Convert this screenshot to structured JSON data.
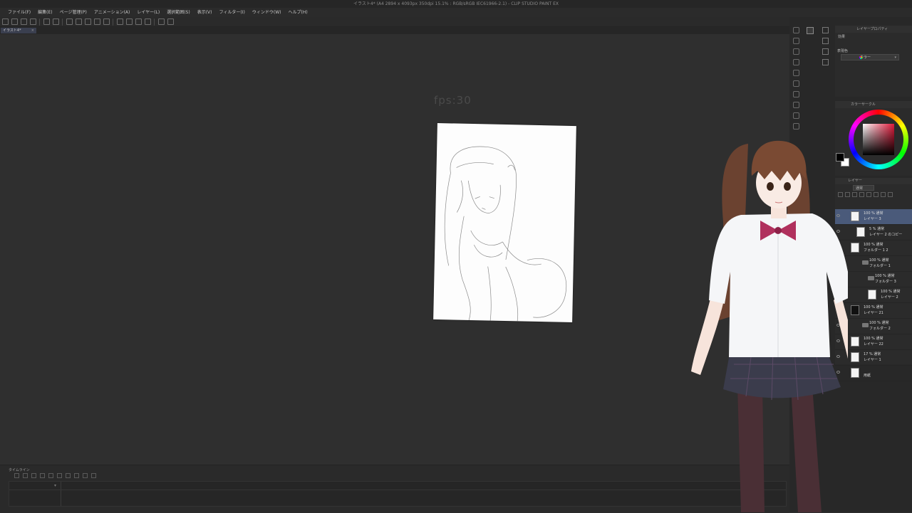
{
  "app": {
    "title": "イラスト4* (A4 2894 x 4093px 350dpi 15.1% : RGB/sRGB IEC61966-2.1) - CLIP STUDIO PAINT EX"
  },
  "menu": [
    "ファイル(F)",
    "編集(E)",
    "ページ管理(P)",
    "アニメーション(A)",
    "レイヤー(L)",
    "選択範囲(S)",
    "表示(V)",
    "フィルター(I)",
    "ウィンドウ(W)",
    "ヘルプ(H)"
  ],
  "document_tab": {
    "label": "イラスト4*",
    "close": "×"
  },
  "canvas": {
    "overlay_text": "fps:30"
  },
  "timeline": {
    "header": "タイムライン"
  },
  "layer_property": {
    "header": "レイヤープロパティ",
    "effect_label": "効果",
    "expression_label": "表現色",
    "expression_value": "カラー"
  },
  "color_wheel": {
    "header": "カラーサークル",
    "hue_color": "#e01a3b",
    "foreground": "#000000",
    "background": "#ffffff"
  },
  "layer_panel": {
    "header": "レイヤー",
    "blend_mode": "通常",
    "layers": [
      {
        "opacity_mode": "100 % 通常",
        "name": "レイヤー 3",
        "kind": "layer",
        "indent": 0,
        "selected": true
      },
      {
        "opacity_mode": "5 % 通常",
        "name": "レイヤー 2 のコピー",
        "kind": "layer",
        "indent": 1,
        "selected": false
      },
      {
        "opacity_mode": "100 % 通常",
        "name": "フォルダー 1 2",
        "kind": "layer",
        "indent": 0,
        "selected": false
      },
      {
        "opacity_mode": "100 % 通常",
        "name": "フォルダー 1",
        "kind": "folder",
        "indent": 1,
        "selected": false
      },
      {
        "opacity_mode": "100 % 通常",
        "name": "フォルダー 3",
        "kind": "folder",
        "indent": 2,
        "selected": false
      },
      {
        "opacity_mode": "100 % 通常",
        "name": "レイヤー 2",
        "kind": "layer",
        "indent": 3,
        "selected": false
      },
      {
        "opacity_mode": "100 % 通常",
        "name": "レイヤー 21",
        "kind": "dark",
        "indent": 0,
        "selected": false
      },
      {
        "opacity_mode": "100 % 通常",
        "name": "フォルダー 2",
        "kind": "folder",
        "indent": 1,
        "selected": false
      },
      {
        "opacity_mode": "100 % 通常",
        "name": "レイヤー 22",
        "kind": "layer",
        "indent": 0,
        "selected": false
      },
      {
        "opacity_mode": "17 % 通常",
        "name": "レイヤー 1",
        "kind": "layer",
        "indent": 0,
        "selected": false
      },
      {
        "opacity_mode": "",
        "name": "用紙",
        "kind": "layer",
        "indent": 0,
        "selected": false
      }
    ]
  }
}
